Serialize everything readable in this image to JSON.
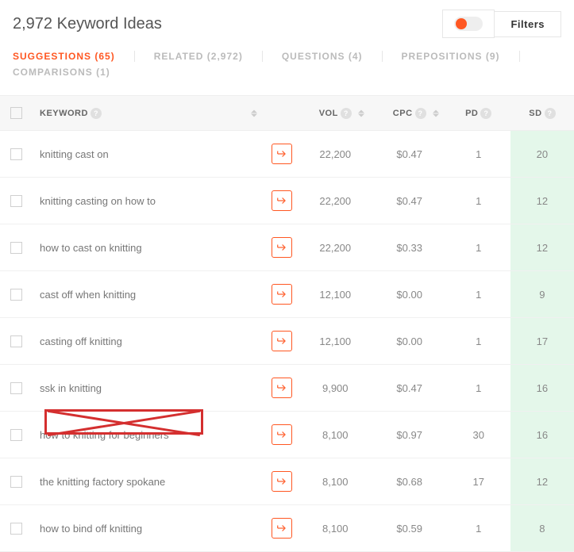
{
  "header": {
    "title": "2,972 Keyword Ideas",
    "filters_label": "Filters"
  },
  "tabs": [
    {
      "label": "SUGGESTIONS (65)",
      "active": true
    },
    {
      "label": "RELATED (2,972)",
      "active": false
    },
    {
      "label": "QUESTIONS (4)",
      "active": false
    },
    {
      "label": "PREPOSITIONS (9)",
      "active": false
    },
    {
      "label": "COMPARISONS (1)",
      "active": false
    }
  ],
  "columns": {
    "keyword": "KEYWORD",
    "vol": "VOL",
    "cpc": "CPC",
    "pd": "PD",
    "sd": "SD"
  },
  "rows": [
    {
      "keyword": "knitting cast on",
      "vol": "22,200",
      "cpc": "$0.47",
      "pd": "1",
      "sd": "20"
    },
    {
      "keyword": "knitting casting on how to",
      "vol": "22,200",
      "cpc": "$0.47",
      "pd": "1",
      "sd": "12"
    },
    {
      "keyword": "how to cast on knitting",
      "vol": "22,200",
      "cpc": "$0.33",
      "pd": "1",
      "sd": "12"
    },
    {
      "keyword": "cast off when knitting",
      "vol": "12,100",
      "cpc": "$0.00",
      "pd": "1",
      "sd": "9"
    },
    {
      "keyword": "casting off knitting",
      "vol": "12,100",
      "cpc": "$0.00",
      "pd": "1",
      "sd": "17"
    },
    {
      "keyword": "ssk in knitting",
      "vol": "9,900",
      "cpc": "$0.47",
      "pd": "1",
      "sd": "16"
    },
    {
      "keyword": "how to knitting for beginners",
      "vol": "8,100",
      "cpc": "$0.97",
      "pd": "30",
      "sd": "16"
    },
    {
      "keyword": "the knitting factory spokane",
      "vol": "8,100",
      "cpc": "$0.68",
      "pd": "17",
      "sd": "12"
    },
    {
      "keyword": "how to bind off knitting",
      "vol": "8,100",
      "cpc": "$0.59",
      "pd": "1",
      "sd": "8"
    }
  ],
  "annotation": {
    "crossed_out_row_index": 7
  }
}
